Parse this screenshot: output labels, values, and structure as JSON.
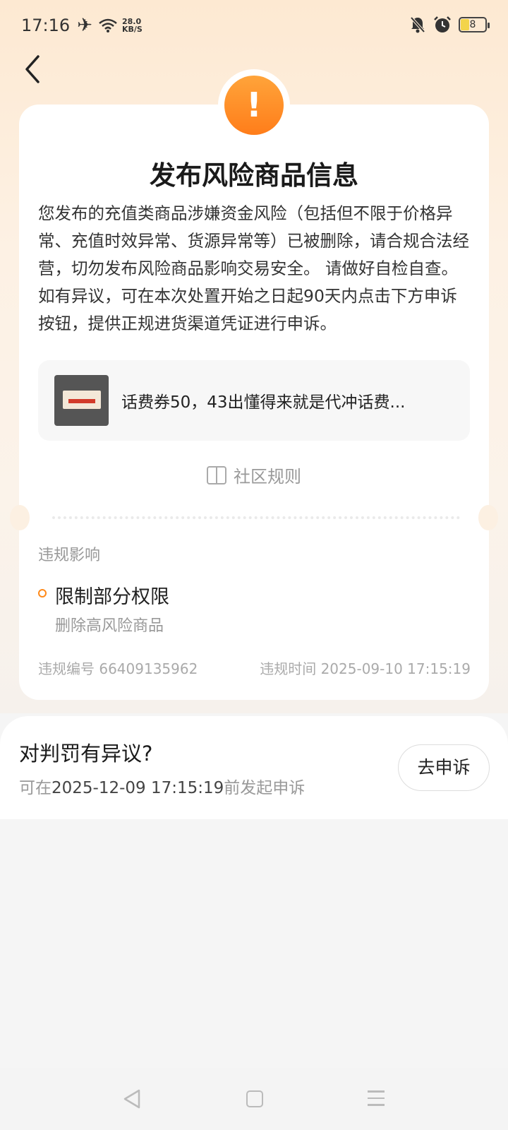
{
  "status_bar": {
    "time": "17:16",
    "speed_value": "28.0",
    "speed_unit": "KB/S",
    "battery": "8"
  },
  "header": {
    "title": "发布风险商品信息",
    "description": "您发布的充值类商品涉嫌资金风险（包括但不限于价格异常、充值时效异常、货源异常等）已被删除，请合规合法经营，切勿发布风险商品影响交易安全。 请做好自检自查。如有异议，可在本次处置开始之日起90天内点击下方申诉按钮，提供正规进货渠道凭证进行申诉。"
  },
  "goods": {
    "title": "话费券50，43出懂得来就是代冲话费..."
  },
  "rules_link": "社区规则",
  "impact": {
    "label": "违规影响",
    "title": "限制部分权限",
    "detail": "删除高风险商品"
  },
  "meta": {
    "id_text": "违规编号 66409135962",
    "time_text": "违规时间 2025-09-10 17:15:19"
  },
  "appeal": {
    "title": "对判罚有异议?",
    "prefix": "可在",
    "deadline": "2025-12-09 17:15:19",
    "suffix": "前发起申诉",
    "button": "去申诉"
  },
  "colors": {
    "accent": "#ff8a1a",
    "warning_gradient_top": "#ffa43a",
    "warning_gradient_bottom": "#ff7d1a"
  },
  "icons": {
    "status": [
      "airplane-icon",
      "wifi-icon",
      "mute-icon",
      "alarm-icon",
      "battery-icon"
    ],
    "back": "chevron-left-icon",
    "warning": "exclamation-icon",
    "rules": "book-icon",
    "nav": [
      "nav-back-icon",
      "nav-home-icon",
      "nav-menu-icon"
    ]
  }
}
